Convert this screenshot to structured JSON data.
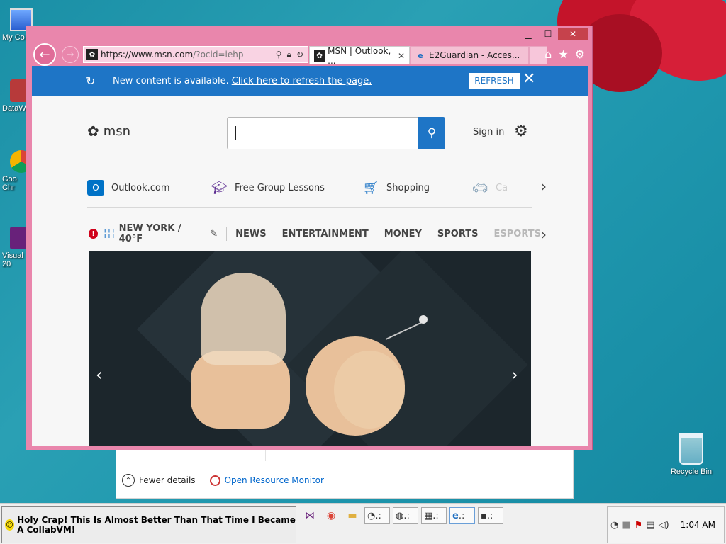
{
  "desktop": {
    "icons": [
      {
        "label": "My Co"
      },
      {
        "label": "DataW"
      },
      {
        "label": "Goo"
      },
      {
        "label": "Chr"
      },
      {
        "label": "Visual"
      },
      {
        "label": "20"
      }
    ],
    "recycle_bin": "Recycle Bin"
  },
  "taskmgr": {
    "fewer_details": "Fewer details",
    "open_resource_monitor": "Open Resource Monitor"
  },
  "browser": {
    "address": {
      "host": "https://www.msn.com",
      "path": "/?ocid=iehp"
    },
    "tabs": [
      {
        "label": "MSN | Outlook, ...",
        "active": true
      },
      {
        "label": "E2Guardian - Acces...",
        "active": false
      }
    ],
    "notification": {
      "message": "New content is available.",
      "link": "Click here to refresh the page.",
      "button": "REFRESH"
    }
  },
  "msn": {
    "logo_text": "msn",
    "search_placeholder": "",
    "sign_in": "Sign in",
    "quicklinks": [
      {
        "label": "Outlook.com",
        "icon": "outlook-icon"
      },
      {
        "label": "Free Group Lessons",
        "icon": "graduation-cap-icon"
      },
      {
        "label": "Shopping",
        "icon": "shopping-cart-icon"
      },
      {
        "label": "Ca",
        "icon": "car-icon"
      }
    ],
    "weather": "NEW YORK / 40°F",
    "categories": [
      "NEWS",
      "ENTERTAINMENT",
      "MONEY",
      "SPORTS",
      "ESPORTS"
    ]
  },
  "taskbar": {
    "start_label": "Holy Crap! This Is Almost Better Than That Time I Became A CollabVM!",
    "clock": "1:04 AM"
  },
  "colors": {
    "ie_frame": "#e986ac",
    "msn_blue": "#1e75c6",
    "alert_red": "#d0021b"
  }
}
